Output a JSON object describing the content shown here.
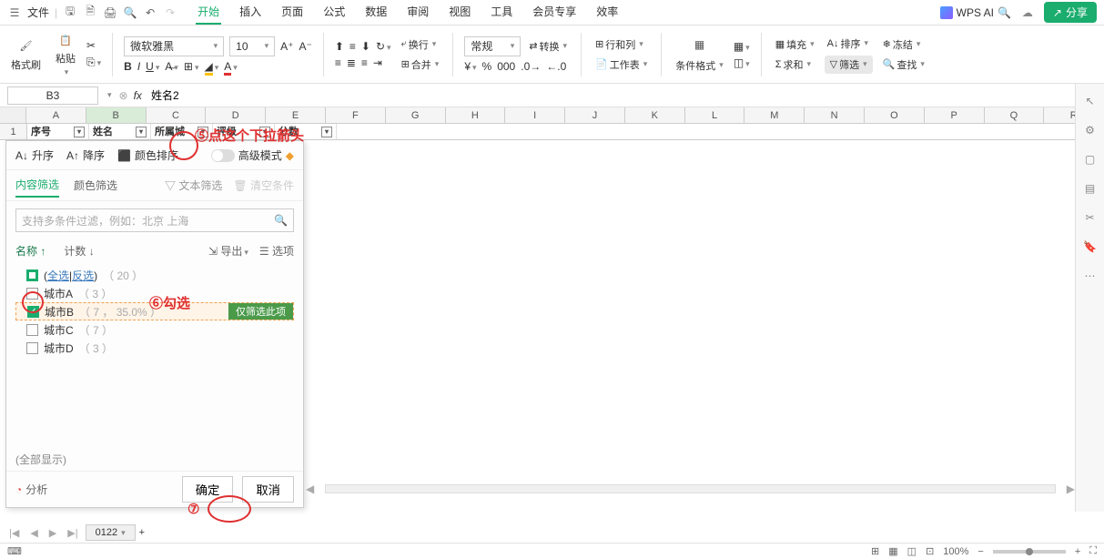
{
  "topbar": {
    "file_label": "文件",
    "menu_tabs": [
      "开始",
      "插入",
      "页面",
      "公式",
      "数据",
      "审阅",
      "视图",
      "工具",
      "会员专享",
      "效率"
    ],
    "active_tab_index": 0,
    "wps_ai_label": "WPS AI",
    "share_label": "分享"
  },
  "ribbon": {
    "format_painter": "格式刷",
    "paste": "粘贴",
    "font_name": "微软雅黑",
    "font_size": "10",
    "wrap": "换行",
    "merge": "合并",
    "general": "常规",
    "convert": "转换",
    "row_col": "行和列",
    "worksheet": "工作表",
    "cond_format": "条件格式",
    "fill": "填充",
    "sort": "排序",
    "freeze": "冻结",
    "sum": "求和",
    "filter": "筛选",
    "find": "查找"
  },
  "formula_bar": {
    "name_box": "B3",
    "formula": "姓名2"
  },
  "columns": [
    "A",
    "B",
    "C",
    "D",
    "E",
    "F",
    "G",
    "H",
    "I",
    "J",
    "K",
    "L",
    "M",
    "N",
    "O",
    "P",
    "Q",
    "R"
  ],
  "header_row": {
    "row_num": "1",
    "cells": [
      "序号",
      "姓名",
      "所属城",
      "评级",
      "分数"
    ]
  },
  "filter_panel": {
    "asc": "升序",
    "desc": "降序",
    "color_sort": "颜色排序",
    "adv_mode": "高级模式",
    "tab_content": "内容筛选",
    "tab_color": "颜色筛选",
    "text_filter": "文本筛选",
    "clear_cond": "清空条件",
    "search_placeholder": "支持多条件过滤，例如：北京  上海",
    "col_name": "名称",
    "col_count": "计数",
    "export": "导出",
    "options": "选项",
    "select_all": "全选",
    "invert": "反选",
    "total_count": "（ 20 ）",
    "items": [
      {
        "name": "城市A",
        "count": "（ 3 ）",
        "checked": false
      },
      {
        "name": "城市B",
        "count": "（ 7 ， 35.0% ）",
        "checked": true,
        "selected": true,
        "only": "仅筛选此项"
      },
      {
        "name": "城市C",
        "count": "（ 7 ）",
        "checked": false
      },
      {
        "name": "城市D",
        "count": "（ 3 ）",
        "checked": false
      }
    ],
    "show_all": "(全部显示)",
    "analyze": "分析",
    "ok": "确定",
    "cancel": "取消"
  },
  "sheet_tabs": {
    "tab1": "0122",
    "add": "+"
  },
  "status": {
    "zoom": "100%"
  },
  "annotations": {
    "a5": "⑤点这个下拉箭头",
    "a6": "⑥勾选",
    "a7": "⑦"
  }
}
